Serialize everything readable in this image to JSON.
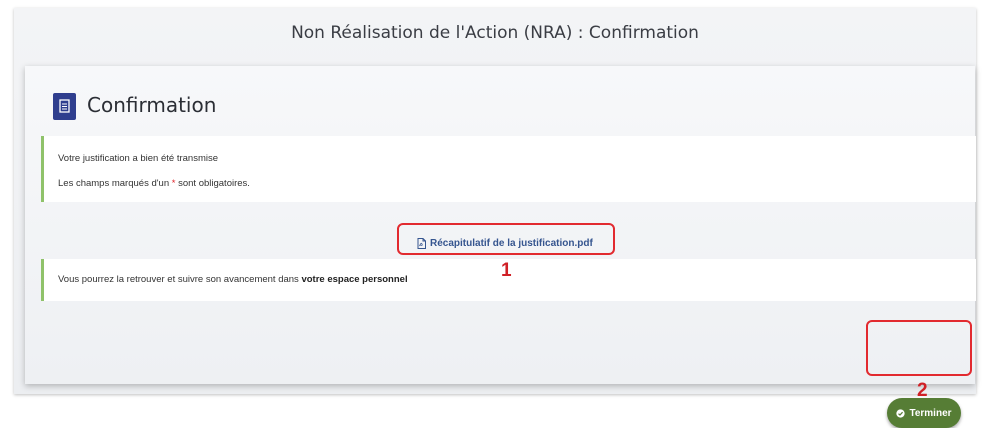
{
  "page": {
    "title": "Non Réalisation de l'Action (NRA) : Confirmation"
  },
  "card": {
    "header_title": "Confirmation",
    "info_line1": "Votre justification a bien été transmise",
    "info_line2_prefix": "Les champs marqués d'un",
    "info_line2_star": "*",
    "info_line2_suffix": "sont obligatoires.",
    "pdf_link_label": "Récapitulatif de la justification.pdf",
    "info2_prefix": "Vous pourrez la retrouver et suivre son avancement dans",
    "info2_bold": "votre espace personnel",
    "finish_button": "Terminer"
  },
  "annotations": {
    "marker1": "1",
    "marker2": "2"
  },
  "colors": {
    "accent_green": "#567d35",
    "info_border": "#8fc26a",
    "header_icon": "#2f3e8e",
    "link": "#35558f",
    "annotation": "#e22a2f"
  },
  "icons": {
    "header": "document-icon",
    "pdf": "pdf-file-icon",
    "finish": "check-circle-icon"
  }
}
